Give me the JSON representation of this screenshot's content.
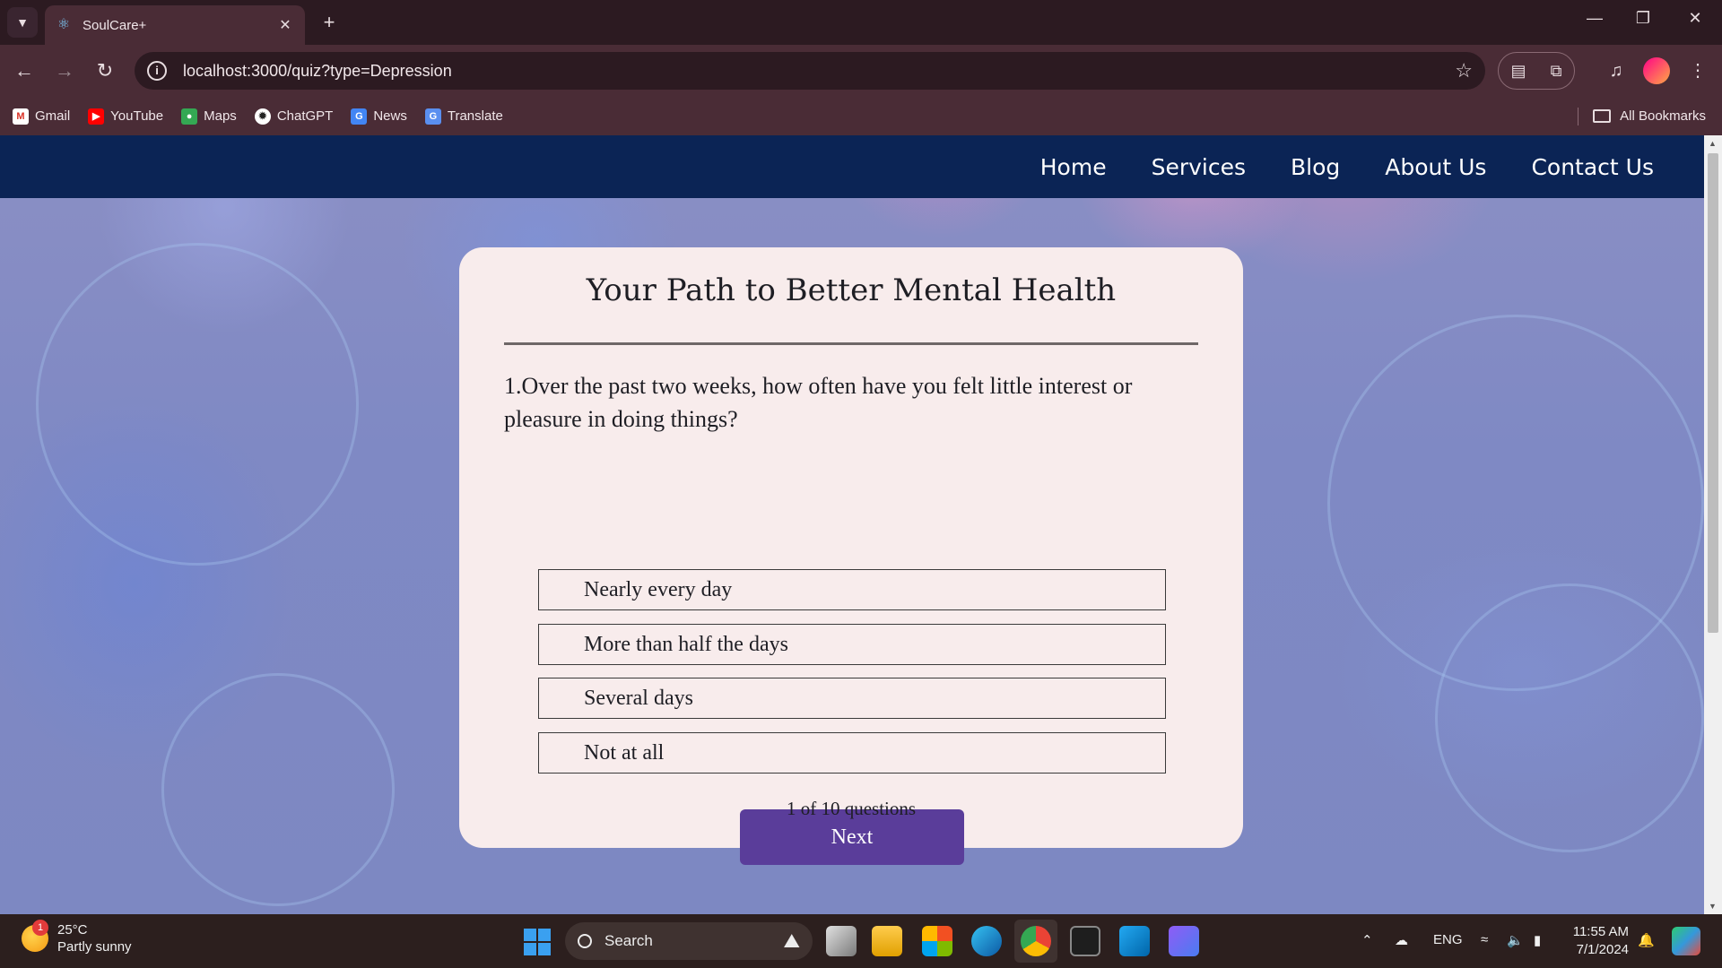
{
  "browser": {
    "tab_title": "SoulCare+",
    "url": "localhost:3000/quiz?type=Depression",
    "bookmarks": [
      "Gmail",
      "YouTube",
      "Maps",
      "ChatGPT",
      "News",
      "Translate"
    ],
    "all_bookmarks_label": "All Bookmarks"
  },
  "site_nav": {
    "items": [
      "Home",
      "Services",
      "Blog",
      "About Us",
      "Contact Us"
    ]
  },
  "quiz": {
    "title": "Your Path to Better Mental Health",
    "question": "1.Over the past two weeks, how often have you felt little interest or pleasure in doing things?",
    "options": [
      "Nearly every day",
      "More than half the days",
      "Several days",
      "Not at all"
    ],
    "next_label": "Next",
    "progress_text": "1 of 10 questions"
  },
  "taskbar": {
    "weather_temp": "25°C",
    "weather_condition": "Partly sunny",
    "weather_badge": "1",
    "search_label": "Search",
    "language": "ENG",
    "time": "11:55 AM",
    "date": "7/1/2024"
  },
  "colors": {
    "nav_bg": "#0b2455",
    "card_bg": "#f8ecec",
    "next_button": "#5a3d9a"
  }
}
